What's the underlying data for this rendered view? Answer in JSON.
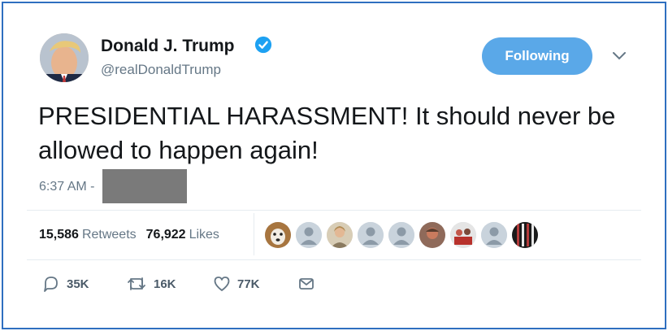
{
  "author": {
    "name": "Donald J. Trump",
    "handle": "@realDonaldTrump",
    "verified": true
  },
  "follow_button": {
    "label": "Following"
  },
  "tweet": {
    "text": "PRESIDENTIAL HARASSMENT! It should never be allowed to happen again!",
    "time": "6:37 AM -"
  },
  "stats": {
    "retweets_count": "15,586",
    "retweets_label": "Retweets",
    "likes_count": "76,922",
    "likes_label": "Likes"
  },
  "likers": [
    "dog-avatar",
    "default-avatar",
    "person-avatar",
    "default-avatar",
    "default-avatar",
    "person-avatar",
    "group-avatar",
    "default-avatar",
    "flag-avatar"
  ],
  "actions": {
    "replies": "35K",
    "retweets": "16K",
    "likes": "77K"
  },
  "colors": {
    "frame": "#2f6fc0",
    "follow_button": "#5aa8e8",
    "verified": "#1da1f2",
    "muted_text": "#657786",
    "redaction": "#7a7a7a"
  }
}
